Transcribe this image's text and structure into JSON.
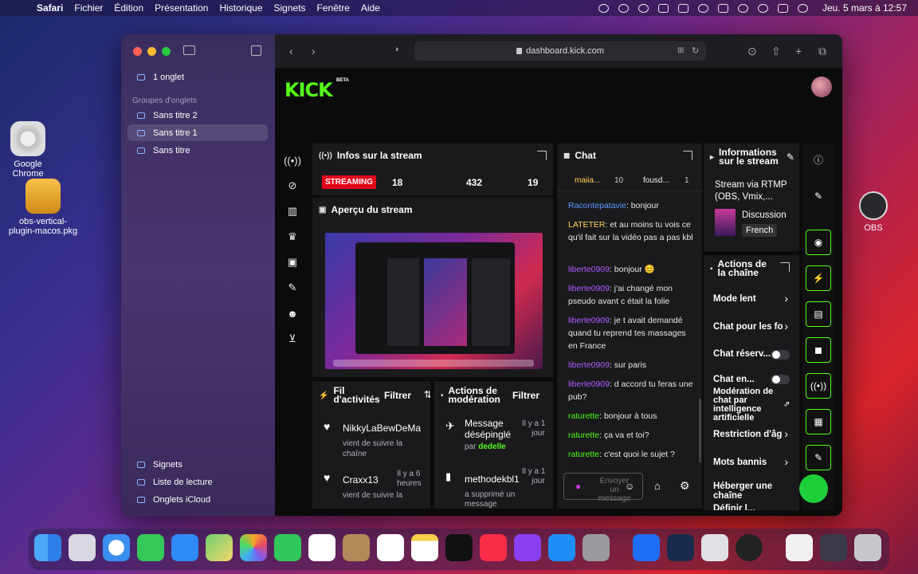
{
  "menubar": {
    "app": "Safari",
    "items": [
      "Fichier",
      "Édition",
      "Présentation",
      "Historique",
      "Signets",
      "Fenêtre",
      "Aide"
    ],
    "clock": "Jeu. 5 mars à 12:57"
  },
  "desktop": {
    "chrome_label": "Google Chrome",
    "pkg_label_1": "obs-vertical-",
    "pkg_label_2": "plugin-macos.pkg",
    "obs_label": "OBS"
  },
  "sidebar": {
    "tab_count": "1 onglet",
    "group_heading": "Groupes d'onglets",
    "groups": [
      "Sans titre 2",
      "Sans titre 1",
      "Sans titre"
    ],
    "bookmarks": "Signets",
    "reading_list": "Liste de lecture",
    "icloud_tabs": "Onglets iCloud"
  },
  "browser": {
    "url": "dashboard.kick.com"
  },
  "kick": {
    "logo": "KICK",
    "beta": "BETA",
    "stream_info": {
      "title": "Infos sur la stream",
      "badge": "STREAMING",
      "stat1": "18",
      "stat2": "432",
      "stat3": "19"
    },
    "preview_title": "Aperçu du stream",
    "activity": {
      "title_1": "Fil",
      "title_2": "d'activités",
      "filter": "Filtrer",
      "items": [
        {
          "user": "NikkyLaBewDeMa",
          "desc_1": "vient de suivre la",
          "desc_2": "chaîne"
        },
        {
          "user": "Craxx13",
          "time_1": "Il y a 6",
          "time_2": "heures",
          "desc_1": "vient de suivre la"
        }
      ]
    },
    "moderation": {
      "title_1": "Actions de",
      "title_2": "modération",
      "filter": "Filtrer",
      "items": [
        {
          "title_1": "Message",
          "title_2": "désépinglé",
          "by_prefix": "par",
          "by_user": "dedelle",
          "time_1": "Il y a 1",
          "time_2": "jour"
        },
        {
          "title_1": "methodekbl1",
          "desc_1": "a supprimé un",
          "desc_2": "message",
          "time_1": "Il y a 1",
          "time_2": "jour"
        }
      ]
    },
    "chat": {
      "title": "Chat",
      "pinned_1": "maiia...",
      "pinned_1_count": "10",
      "pinned_2": "fousd...",
      "pinned_2_count": "1",
      "messages": [
        {
          "user": "Racontepatavie",
          "text": ": bonjour"
        },
        {
          "user": "LATETER",
          "text": ": et au moins tu vois ce qu'il fait sur la vidéo pas a pas kbl"
        },
        {
          "user": "liberte0909",
          "text": ": bonjour 😊"
        },
        {
          "user": "liberte0909",
          "text": ": j'ai changé mon pseudo avant c était la folie"
        },
        {
          "user": "liberte0909",
          "text": ": je t avait demandé quand tu reprend tes massages en France"
        },
        {
          "user": "liberte0909",
          "text": ": sur paris"
        },
        {
          "user": "liberte0909",
          "text": ": d accord tu feras une pub?"
        },
        {
          "user": "raturette",
          "text": ": bonjour à tous"
        },
        {
          "user": "raturette",
          "text": ": ça va et toi?"
        },
        {
          "user": "raturette",
          "text": ": c'est quoi le sujet ?"
        }
      ],
      "input_placeholder": "Envoyer un message"
    },
    "channel_info": {
      "title_1": "Informations",
      "title_2": "sur le stream",
      "rtmp_1": "Stream via RTMP",
      "rtmp_2": "(OBS, Vmix,...",
      "category": "Discussion",
      "language": "French"
    },
    "channel_actions": {
      "title_1": "Actions de",
      "title_2": "la chaîne",
      "slow_mode": "Mode lent",
      "followers_chat": "Chat pour les fo",
      "reserved_chat": "Chat réserv...",
      "chat_en": "Chat en...",
      "ai_mod_1": "Modération de",
      "ai_mod_2": "chat par",
      "ai_mod_3": "intelligence",
      "ai_mod_4": "artificielle",
      "age_restriction": "Restriction d'âg",
      "banned_words": "Mots bannis",
      "host_channel": "Héberger une chaîne",
      "more": "Définir l..."
    }
  },
  "colors": {
    "kick_green": "#53fc18",
    "streaming_red": "#e3061b",
    "panel_bg": "#1a1a1d"
  }
}
